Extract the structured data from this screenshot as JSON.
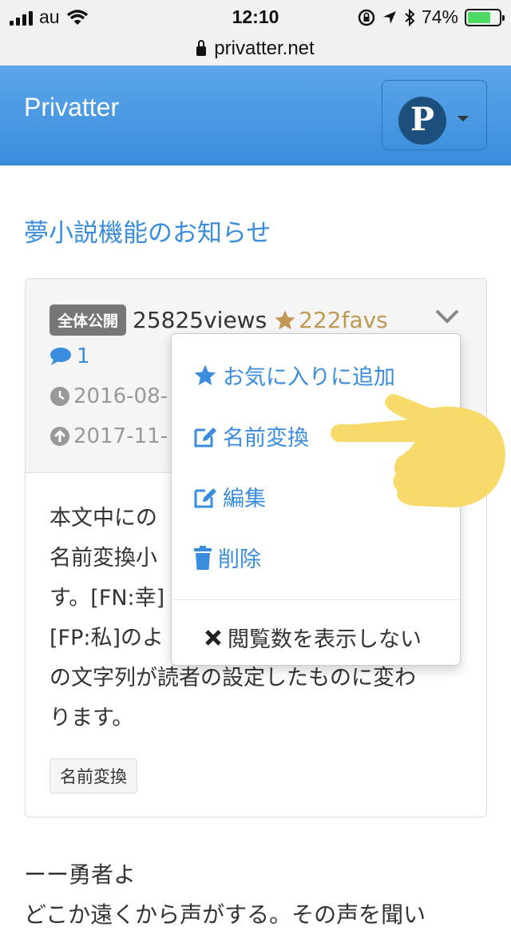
{
  "status_bar": {
    "carrier": "au",
    "time": "12:10",
    "battery": "74%",
    "battery_level": 0.74
  },
  "browser": {
    "url": "privatter.net"
  },
  "navbar": {
    "brand": "Privatter",
    "avatar_letter": "P"
  },
  "page": {
    "title": "夢小説機能のお知らせ"
  },
  "post": {
    "visibility": "全体公開",
    "views": "25825views",
    "favs": "222favs",
    "comments": "1",
    "created": "2016-08-",
    "updated": "2017-11-",
    "body_lines": [
      "本文中にの",
      "名前変換小",
      "す。[FN:幸]",
      "[FP:私]のよ",
      "の文字列が読者の設定したものに変わ",
      "ります。"
    ],
    "tag": "名前変換"
  },
  "dropdown": {
    "add_favorite": "お気に入りに追加",
    "name_convert": "名前変換",
    "edit": "編集",
    "delete": "削除",
    "hide_views": "閲覧数を表示しない"
  },
  "story": {
    "line1": "ーー勇者よ",
    "line2": "どこか遠くから声がする。その声を聞い"
  },
  "colors": {
    "brand_blue": "#3a8ddd",
    "fav_gold": "#c09853",
    "hand_yellow": "#f8da6a"
  }
}
